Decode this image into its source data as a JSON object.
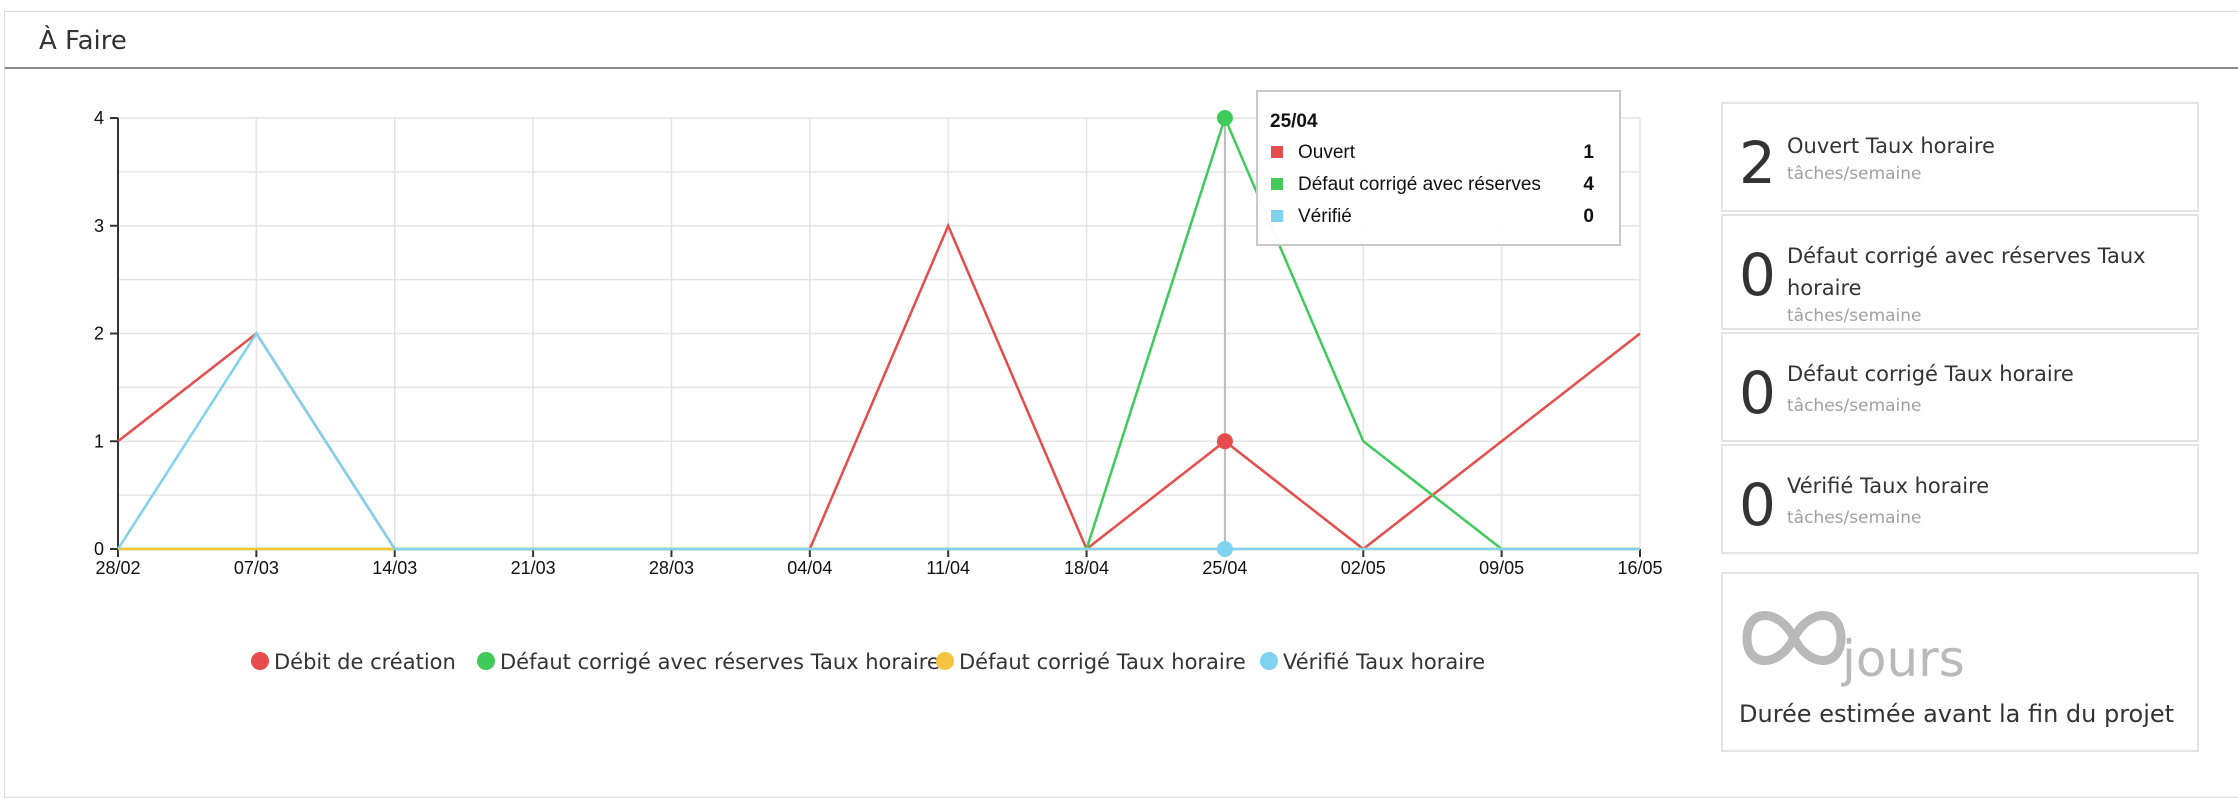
{
  "panel": {
    "title": "À Faire"
  },
  "chart_data": {
    "type": "line",
    "x": [
      "28/02",
      "07/03",
      "14/03",
      "21/03",
      "28/03",
      "04/04",
      "11/04",
      "18/04",
      "25/04",
      "02/05",
      "09/05",
      "16/05"
    ],
    "ylim": [
      0,
      4
    ],
    "yticks": [
      "0",
      "1",
      "2",
      "3",
      "4"
    ],
    "grid": true,
    "legend_position": "bottom",
    "series": [
      {
        "name": "Débit de création",
        "color": "#e74c4c",
        "values": [
          1,
          2,
          0,
          0,
          0,
          0,
          3,
          0,
          1,
          0,
          1,
          2
        ]
      },
      {
        "name": "Défaut corrigé avec réserves Taux horaire",
        "color": "#3ecb5a",
        "values": [
          0,
          0,
          0,
          0,
          0,
          0,
          0,
          0,
          4,
          1,
          0,
          0
        ]
      },
      {
        "name": "Défaut corrigé Taux horaire",
        "color": "#f7c43d",
        "values": [
          0,
          0,
          0,
          0,
          0,
          0,
          0,
          0,
          0,
          0,
          0,
          0
        ]
      },
      {
        "name": "Vérifié Taux horaire",
        "color": "#7fd3ee",
        "values": [
          0,
          2,
          0,
          0,
          0,
          0,
          0,
          0,
          0,
          0,
          0,
          0
        ]
      }
    ],
    "highlight_index": 8,
    "tooltip": {
      "title": "25/04",
      "rows": [
        {
          "label": "Ouvert",
          "value": "1",
          "color": "#e74c4c"
        },
        {
          "label": "Défaut corrigé avec réserves",
          "value": "4",
          "color": "#3ecb5a"
        },
        {
          "label": "Vérifié",
          "value": "0",
          "color": "#7fd3ee"
        }
      ]
    }
  },
  "stats": [
    {
      "value": "2",
      "label": "Ouvert Taux horaire",
      "sub": "tâches/semaine"
    },
    {
      "value": "0",
      "label": "Défaut corrigé avec réserves Taux horaire",
      "sub": "tâches/semaine"
    },
    {
      "value": "0",
      "label": "Défaut corrigé Taux horaire",
      "sub": "tâches/semaine"
    },
    {
      "value": "0",
      "label": "Vérifié Taux horaire",
      "sub": "tâches/semaine"
    }
  ],
  "estimate": {
    "value": "∞",
    "unit": "jours",
    "label": "Durée estimée avant la fin du projet"
  }
}
